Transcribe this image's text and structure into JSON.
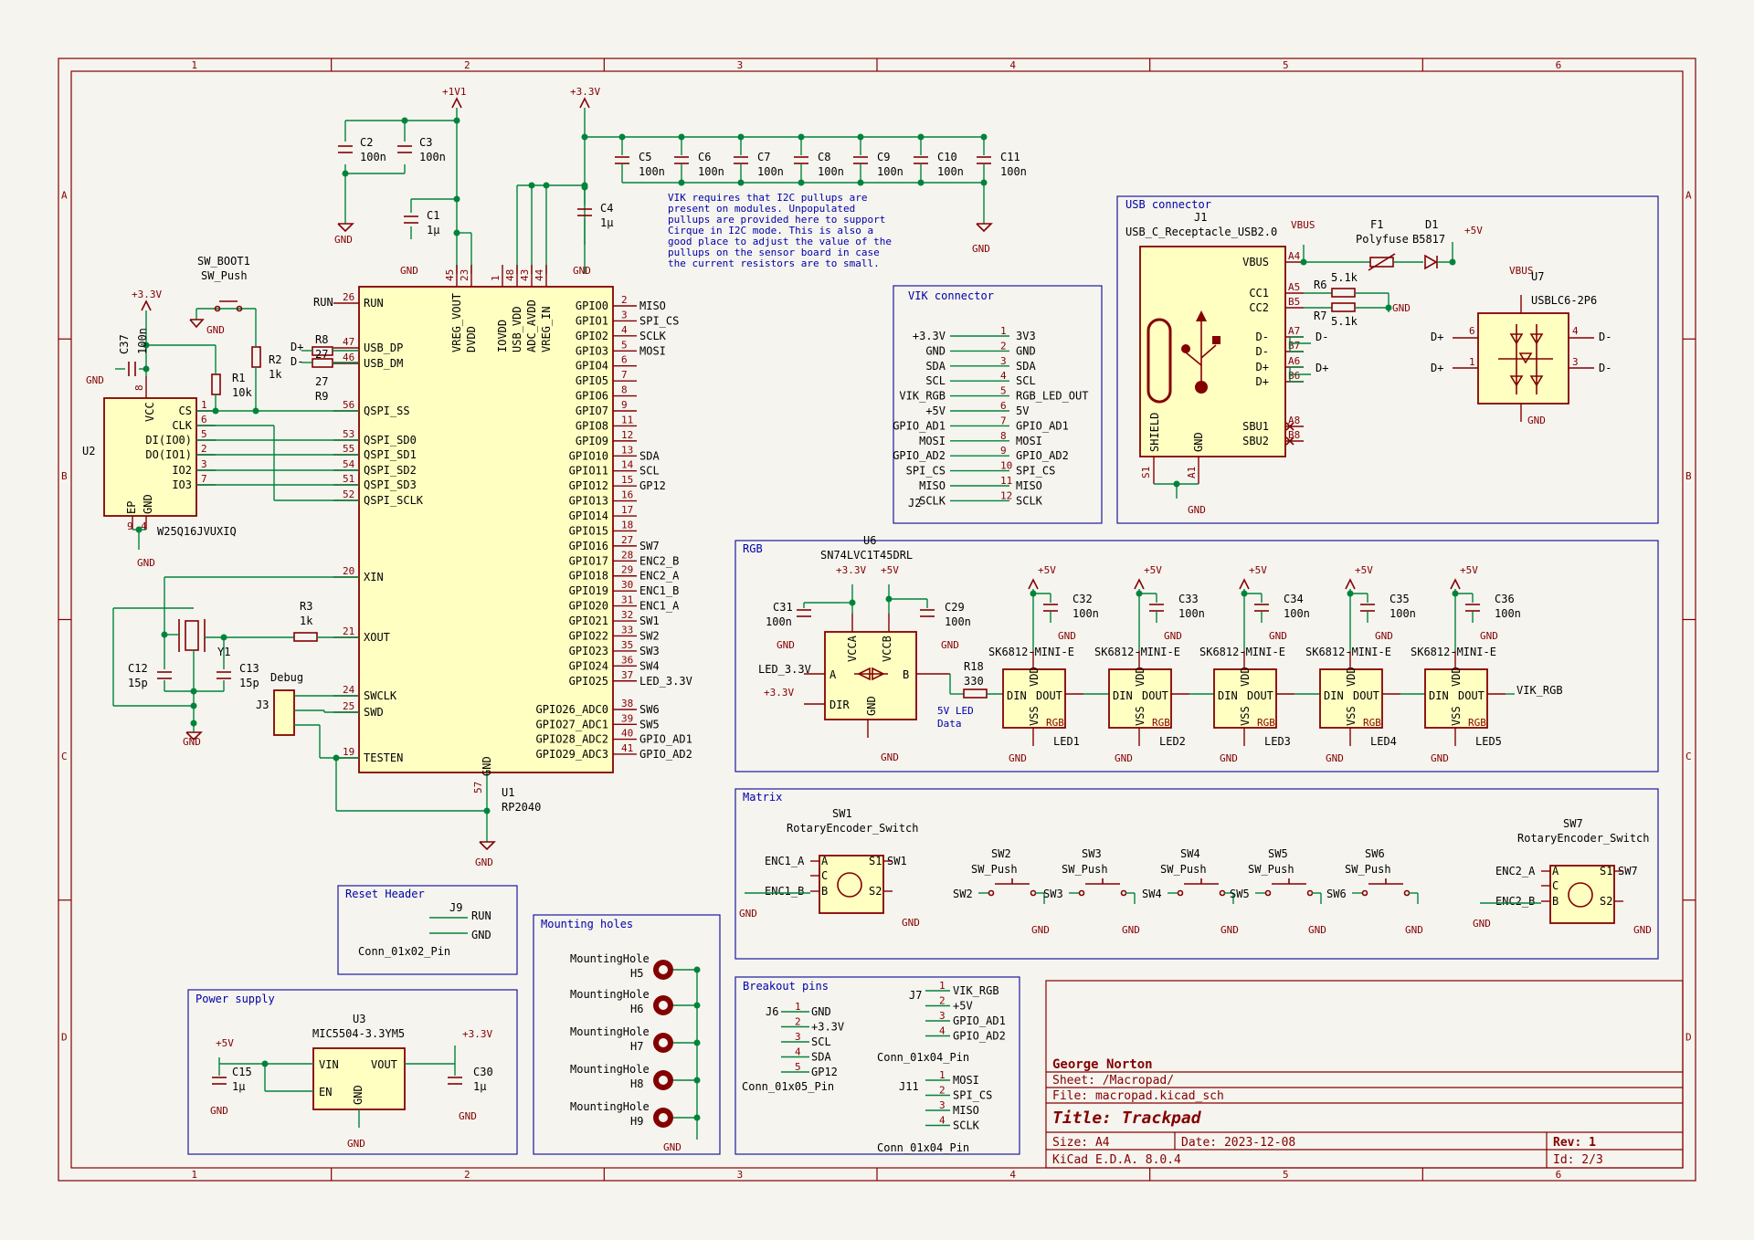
{
  "border": {
    "cols": [
      "1",
      "2",
      "3",
      "4",
      "5",
      "6"
    ],
    "rows": [
      "A",
      "B",
      "C",
      "D"
    ]
  },
  "title_block": {
    "company": "George Norton",
    "sheet": "Sheet: /Macropad/",
    "file": "File: macropad.kicad_sch",
    "title": "Title: Trackpad",
    "size": "Size: A4",
    "date": "Date: 2023-12-08",
    "rev": "Rev: 1",
    "tool": "KiCad E.D.A. 8.0.4",
    "id": "Id: 2/3"
  },
  "power": {
    "v1v1": "+1V1",
    "v3v3": "+3.3V",
    "gnd": "GND",
    "v5": "+5V",
    "vbus": "VBUS"
  },
  "caps_top": [
    {
      "ref": "C2",
      "val": "100n"
    },
    {
      "ref": "C3",
      "val": "100n"
    },
    {
      "ref": "C5",
      "val": "100n"
    },
    {
      "ref": "C6",
      "val": "100n"
    },
    {
      "ref": "C7",
      "val": "100n"
    },
    {
      "ref": "C8",
      "val": "100n"
    },
    {
      "ref": "C9",
      "val": "100n"
    },
    {
      "ref": "C10",
      "val": "100n"
    },
    {
      "ref": "C11",
      "val": "100n"
    }
  ],
  "c1": {
    "ref": "C1",
    "val": "1µ"
  },
  "c4": {
    "ref": "C4",
    "val": "1µ"
  },
  "note": [
    "VIK requires that I2C pullups are",
    "present on modules. Unpopulated",
    "pullups are provided here to support",
    "Cirque in I2C mode. This is also a",
    "good place to adjust the value of the",
    "pullups on the sensor board in case",
    "the current resistors are to small."
  ],
  "u1": {
    "ref": "U1",
    "val": "RP2040",
    "left_pins": [
      {
        "num": "26",
        "name": "RUN"
      },
      {
        "num": "47",
        "name": "USB_DP"
      },
      {
        "num": "46",
        "name": "USB_DM"
      },
      {
        "num": "56",
        "name": "QSPI_SS"
      },
      {
        "num": "53",
        "name": "QSPI_SD0"
      },
      {
        "num": "55",
        "name": "QSPI_SD1"
      },
      {
        "num": "54",
        "name": "QSPI_SD2"
      },
      {
        "num": "51",
        "name": "QSPI_SD3"
      },
      {
        "num": "52",
        "name": "QSPI_SCLK"
      },
      {
        "num": "20",
        "name": "XIN"
      },
      {
        "num": "21",
        "name": "XOUT"
      },
      {
        "num": "24",
        "name": "SWCLK"
      },
      {
        "num": "25",
        "name": "SWD"
      },
      {
        "num": "19",
        "name": "TESTEN"
      }
    ],
    "top_pins": [
      {
        "num": "45",
        "name": "VREG_VOUT"
      },
      {
        "num": "23",
        "name": "DVDD"
      },
      {
        "num": "1",
        "name": "IOVDD"
      },
      {
        "num": "48",
        "name": "USB_VDD"
      },
      {
        "num": "43",
        "name": "ADC_AVDD"
      },
      {
        "num": "44",
        "name": "VREG_IN"
      }
    ],
    "bottom_pin": {
      "num": "57",
      "name": "GND"
    },
    "right_pins": [
      {
        "num": "2",
        "name": "GPIO0",
        "net": "MISO"
      },
      {
        "num": "3",
        "name": "GPIO1",
        "net": "SPI_CS"
      },
      {
        "num": "4",
        "name": "GPIO2",
        "net": "SCLK"
      },
      {
        "num": "5",
        "name": "GPIO3",
        "net": "MOSI"
      },
      {
        "num": "6",
        "name": "GPIO4",
        "net": ""
      },
      {
        "num": "7",
        "name": "GPIO5",
        "net": ""
      },
      {
        "num": "8",
        "name": "GPIO6",
        "net": ""
      },
      {
        "num": "9",
        "name": "GPIO7",
        "net": ""
      },
      {
        "num": "11",
        "name": "GPIO8",
        "net": ""
      },
      {
        "num": "12",
        "name": "GPIO9",
        "net": ""
      },
      {
        "num": "13",
        "name": "GPIO10",
        "net": "SDA"
      },
      {
        "num": "14",
        "name": "GPIO11",
        "net": "SCL"
      },
      {
        "num": "15",
        "name": "GPIO12",
        "net": "GP12"
      },
      {
        "num": "16",
        "name": "GPIO13",
        "net": ""
      },
      {
        "num": "17",
        "name": "GPIO14",
        "net": ""
      },
      {
        "num": "18",
        "name": "GPIO15",
        "net": ""
      },
      {
        "num": "27",
        "name": "GPIO16",
        "net": "SW7"
      },
      {
        "num": "28",
        "name": "GPIO17",
        "net": "ENC2_B"
      },
      {
        "num": "29",
        "name": "GPIO18",
        "net": "ENC2_A"
      },
      {
        "num": "30",
        "name": "GPIO19",
        "net": "ENC1_B"
      },
      {
        "num": "31",
        "name": "GPIO20",
        "net": "ENC1_A"
      },
      {
        "num": "32",
        "name": "GPIO21",
        "net": "SW1"
      },
      {
        "num": "33",
        "name": "GPIO22",
        "net": "SW2"
      },
      {
        "num": "35",
        "name": "GPIO23",
        "net": "SW3"
      },
      {
        "num": "36",
        "name": "GPIO24",
        "net": "SW4"
      },
      {
        "num": "37",
        "name": "GPIO25",
        "net": "LED_3.3V"
      },
      {
        "num": "38",
        "name": "GPIO26_ADC0",
        "net": "SW6"
      },
      {
        "num": "39",
        "name": "GPIO27_ADC1",
        "net": "SW5"
      },
      {
        "num": "40",
        "name": "GPIO28_ADC2",
        "net": "GPIO_AD1"
      },
      {
        "num": "41",
        "name": "GPIO29_ADC3",
        "net": "GPIO_AD2"
      }
    ]
  },
  "u2": {
    "ref": "U2",
    "val": "W25Q16JVUXIQ",
    "pins": [
      {
        "num": "1",
        "name": "CS"
      },
      {
        "num": "6",
        "name": "CLK"
      },
      {
        "num": "5",
        "name": "DI(IO0)"
      },
      {
        "num": "2",
        "name": "DO(IO1)"
      },
      {
        "num": "3",
        "name": "IO2"
      },
      {
        "num": "7",
        "name": "IO3"
      }
    ],
    "vcc": "VCC",
    "vcc_num": "8",
    "ep": "EP",
    "gnd": "GND",
    "ep_num": "9",
    "gnd_num": "4"
  },
  "sw_boot": {
    "ref": "SW_BOOT1",
    "val": "SW_Push"
  },
  "resistors": {
    "r1": {
      "ref": "R1",
      "val": "10k"
    },
    "r2": {
      "ref": "R2",
      "val": "1k"
    },
    "r8": {
      "ref": "R8",
      "val": "27"
    },
    "r9": {
      "ref": "R9",
      "val": "27"
    },
    "r3": {
      "ref": "R3",
      "val": "1k"
    }
  },
  "c37": {
    "ref": "C37",
    "val": "100n"
  },
  "dplus": "D+",
  "dminus": "D-",
  "crystal": {
    "ref": "Y1",
    "c12": "C12",
    "c12v": "15p",
    "c13": "C13",
    "c13v": "15p"
  },
  "debug": {
    "label": "Debug",
    "ref": "J3"
  },
  "reset_header": {
    "title": "Reset Header",
    "ref": "J9",
    "val": "Conn_01x02_Pin",
    "n1": "RUN",
    "n2": "GND"
  },
  "power_supply": {
    "title": "Power supply",
    "ref": "U3",
    "val": "MIC5504-3.3YM5",
    "vin": "VIN",
    "en": "EN",
    "vout": "VOUT",
    "gnd": "GND",
    "c15": "C15",
    "c15v": "1µ",
    "c30": "C30",
    "c30v": "1µ"
  },
  "mounting": {
    "title": "Mounting holes",
    "holes": [
      {
        "ref": "H5"
      },
      {
        "ref": "H6"
      },
      {
        "ref": "H7"
      },
      {
        "ref": "H8"
      },
      {
        "ref": "H9"
      }
    ],
    "label": "MountingHole"
  },
  "breakout": {
    "title": "Breakout pins",
    "j6": {
      "ref": "J6",
      "val": "Conn_01x05_Pin",
      "nets": [
        "GND",
        "+3.3V",
        "SCL",
        "SDA",
        "GP12"
      ]
    },
    "j7": {
      "ref": "J7",
      "val": "Conn_01x04_Pin",
      "nets": [
        "VIK_RGB",
        "+5V",
        "GPIO_AD1",
        "GPIO_AD2"
      ]
    },
    "j11": {
      "ref": "J11",
      "val": "Conn_01x04_Pin",
      "nets": [
        "MOSI",
        "SPI_CS",
        "MISO",
        "SCLK"
      ]
    }
  },
  "vik": {
    "title": "VIK connector",
    "ref": "J2",
    "nets": [
      "+3.3V",
      "GND",
      "SDA",
      "SCL",
      "VIK_RGB",
      "+5V",
      "GPIO_AD1",
      "MOSI",
      "GPIO_AD2",
      "SPI_CS",
      "MISO",
      "SCLK"
    ],
    "pins": [
      "3V3",
      "GND",
      "SDA",
      "SCL",
      "RGB_LED_OUT",
      "5V",
      "GPIO_AD1",
      "MOSI",
      "GPIO_AD2",
      "SPI_CS",
      "MISO",
      "SCLK"
    ]
  },
  "usb": {
    "title": "USB connector",
    "ref": "J1",
    "val": "USB_C_Receptacle_USB2.0",
    "pins": [
      {
        "num": "A4",
        "name": "VBUS"
      },
      {
        "num": "A5",
        "name": "CC1"
      },
      {
        "num": "B5",
        "name": "CC2"
      },
      {
        "num": "A7",
        "name": "D-"
      },
      {
        "num": "B7",
        "name": "D-"
      },
      {
        "num": "A6",
        "name": "D+"
      },
      {
        "num": "B6",
        "name": "D+"
      },
      {
        "num": "A8",
        "name": "SBU1"
      },
      {
        "num": "B8",
        "name": "SBU2"
      }
    ],
    "shield": "SHIELD",
    "gnd": "GND",
    "s1": "S1",
    "a1": "A1",
    "f1": "F1",
    "f1v": "Polyfuse",
    "d1": "D1",
    "d1v": "B5817",
    "r6": "R6",
    "r6v": "5.1k",
    "r7": "R7",
    "r7v": "5.1k",
    "u7": "U7",
    "u7v": "USBLC6-2P6"
  },
  "rgb": {
    "title": "RGB",
    "u6": "U6",
    "u6v": "SN74LVC1T45DRL",
    "vcca": "VCCA",
    "vccb": "VCCB",
    "a": "A",
    "b": "B",
    "dir": "DIR",
    "gnd": "GND",
    "c31": "C31",
    "c31v": "100n",
    "c29": "C29",
    "c29v": "100n",
    "r18": "R18",
    "r18v": "330",
    "led_in": "LED_3.3V",
    "data_lbl1": "5V LED",
    "data_lbl2": "Data",
    "leds": [
      {
        "ref": "LED1",
        "cap": "C32",
        "capv": "100n"
      },
      {
        "ref": "LED2",
        "cap": "C33",
        "capv": "100n"
      },
      {
        "ref": "LED3",
        "cap": "C34",
        "capv": "100n"
      },
      {
        "ref": "LED4",
        "cap": "C35",
        "capv": "100n"
      },
      {
        "ref": "LED5",
        "cap": "C36",
        "capv": "100n"
      }
    ],
    "led_val": "SK6812-MINI-E",
    "din": "DIN",
    "dout": "DOUT",
    "vdd": "VDD",
    "vss": "VSS",
    "rgbtxt": "RGB",
    "out": "VIK_RGB"
  },
  "matrix": {
    "title": "Matrix",
    "sw1": {
      "ref": "SW1",
      "val": "RotaryEncoder_Switch",
      "a": "ENC1_A",
      "b": "ENC1_B",
      "s": "SW1"
    },
    "sw7": {
      "ref": "SW7",
      "val": "RotaryEncoder_Switch",
      "a": "ENC2_A",
      "b": "ENC2_B",
      "s": "SW7"
    },
    "push": [
      {
        "ref": "SW2",
        "net": "SW2"
      },
      {
        "ref": "SW3",
        "net": "SW3"
      },
      {
        "ref": "SW4",
        "net": "SW4"
      },
      {
        "ref": "SW5",
        "net": "SW5"
      },
      {
        "ref": "SW6",
        "net": "SW6"
      }
    ],
    "push_val": "SW_Push"
  }
}
